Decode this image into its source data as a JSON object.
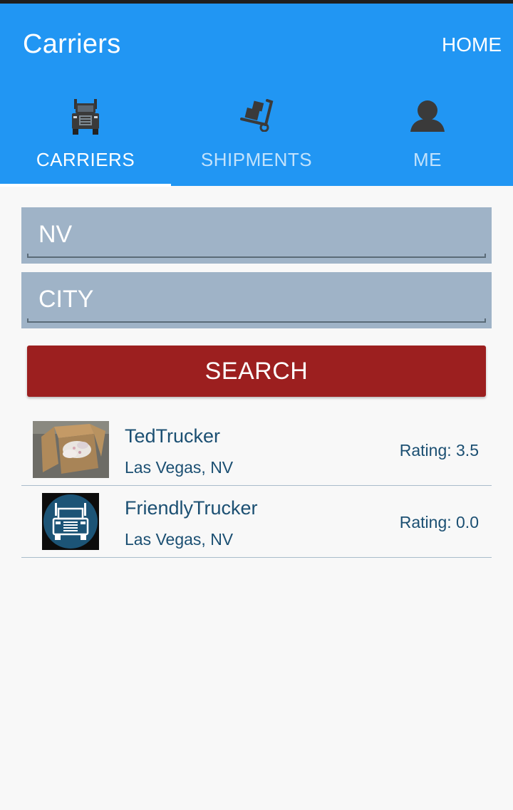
{
  "app": {
    "title": "Carriers",
    "home_label": "HOME"
  },
  "tabs": [
    {
      "label": "CARRIERS",
      "icon": "truck-icon",
      "active": true
    },
    {
      "label": "SHIPMENTS",
      "icon": "hand-truck-icon",
      "active": false
    },
    {
      "label": "ME",
      "icon": "person-icon",
      "active": false
    }
  ],
  "search": {
    "state_value": "NV",
    "city_placeholder": "CITY",
    "button_label": "SEARCH"
  },
  "carriers": [
    {
      "name": "TedTrucker",
      "location": "Las Vegas, NV",
      "rating": "Rating: 3.5",
      "thumb": "box-photo"
    },
    {
      "name": "FriendlyTrucker",
      "location": "Las Vegas, NV",
      "rating": "Rating: 0.0",
      "thumb": "truck-logo"
    }
  ],
  "colors": {
    "appbar": "#2196f3",
    "field_bg": "#9fb3c7",
    "search_button": "#9c1f1f",
    "list_text": "#1b4f72"
  }
}
